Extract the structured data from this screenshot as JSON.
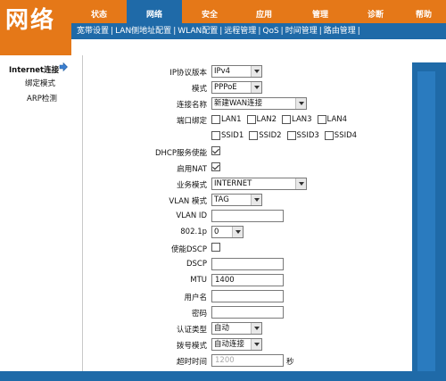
{
  "brand": {
    "title": "网络"
  },
  "nav": {
    "items": [
      {
        "label": "状态",
        "active": false
      },
      {
        "label": "网络",
        "active": true
      },
      {
        "label": "安全",
        "active": false
      },
      {
        "label": "应用",
        "active": false
      },
      {
        "label": "管理",
        "active": false
      },
      {
        "label": "诊断",
        "active": false
      },
      {
        "label": "帮助",
        "active": false
      }
    ]
  },
  "subnav": {
    "items": [
      "宽带设置",
      "LAN侧地址配置",
      "WLAN配置",
      "远程管理",
      "QoS",
      "时间管理",
      "路由管理"
    ]
  },
  "sidebar": {
    "active": "Internet连接",
    "items": [
      "绑定模式",
      "ARP检测"
    ]
  },
  "form": {
    "ip_version": {
      "label": "IP协议版本",
      "value": "IPv4"
    },
    "mode": {
      "label": "模式",
      "value": "PPPoE"
    },
    "conn_name": {
      "label": "连接名称",
      "value": "新建WAN连接"
    },
    "port_bind": {
      "label": "端口绑定",
      "lan": [
        "LAN1",
        "LAN2",
        "LAN3",
        "LAN4"
      ],
      "ssid": [
        "SSID1",
        "SSID2",
        "SSID3",
        "SSID4"
      ]
    },
    "dhcp": {
      "label": "DHCP服务使能",
      "checked": true
    },
    "nat": {
      "label": "启用NAT",
      "checked": true
    },
    "service_mode": {
      "label": "业务模式",
      "value": "INTERNET"
    },
    "vlan_mode": {
      "label": "VLAN 模式",
      "value": "TAG"
    },
    "vlan_id": {
      "label": "VLAN ID",
      "value": ""
    },
    "p8021": {
      "label": "802.1p",
      "value": "0"
    },
    "dscp_enable": {
      "label": "使能DSCP",
      "checked": false
    },
    "dscp": {
      "label": "DSCP",
      "value": ""
    },
    "mtu": {
      "label": "MTU",
      "value": "1400"
    },
    "username": {
      "label": "用户名",
      "value": ""
    },
    "password": {
      "label": "密码",
      "value": ""
    },
    "auth_type": {
      "label": "认证类型",
      "value": "自动"
    },
    "dial_mode": {
      "label": "拨号模式",
      "value": "自动连接"
    },
    "timeout": {
      "label": "超时时间",
      "value": "1200",
      "unit": "秒"
    }
  },
  "colors": {
    "orange": "#e57818",
    "blue": "#1f6aa8"
  }
}
